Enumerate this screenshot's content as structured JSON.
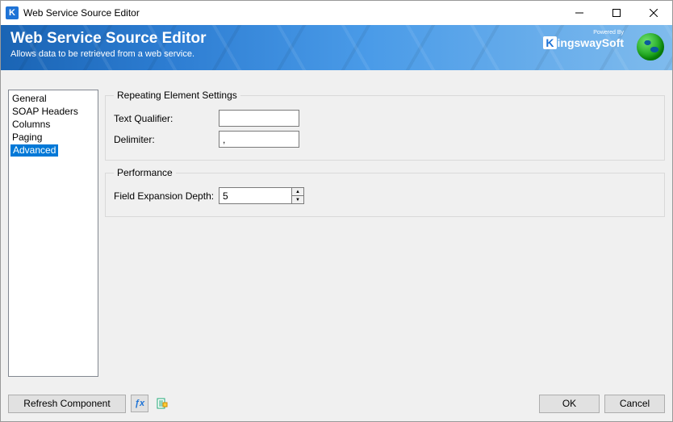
{
  "window": {
    "title": "Web Service Source Editor"
  },
  "banner": {
    "heading": "Web Service Source Editor",
    "subtitle": "Allows data to be retrieved from a web service.",
    "powered_by": "Powered By",
    "brand_k": "K",
    "brand_rest": "ingswaySoft"
  },
  "sidebar": {
    "items": [
      "General",
      "SOAP Headers",
      "Columns",
      "Paging",
      "Advanced"
    ],
    "selected_index": 4
  },
  "groups": {
    "repeating": {
      "legend": "Repeating Element Settings",
      "text_qualifier_label": "Text Qualifier:",
      "text_qualifier_value": "",
      "delimiter_label": "Delimiter:",
      "delimiter_value": ","
    },
    "performance": {
      "legend": "Performance",
      "field_expansion_label": "Field Expansion Depth:",
      "field_expansion_value": "5"
    }
  },
  "footer": {
    "refresh": "Refresh Component",
    "ok": "OK",
    "cancel": "Cancel"
  }
}
